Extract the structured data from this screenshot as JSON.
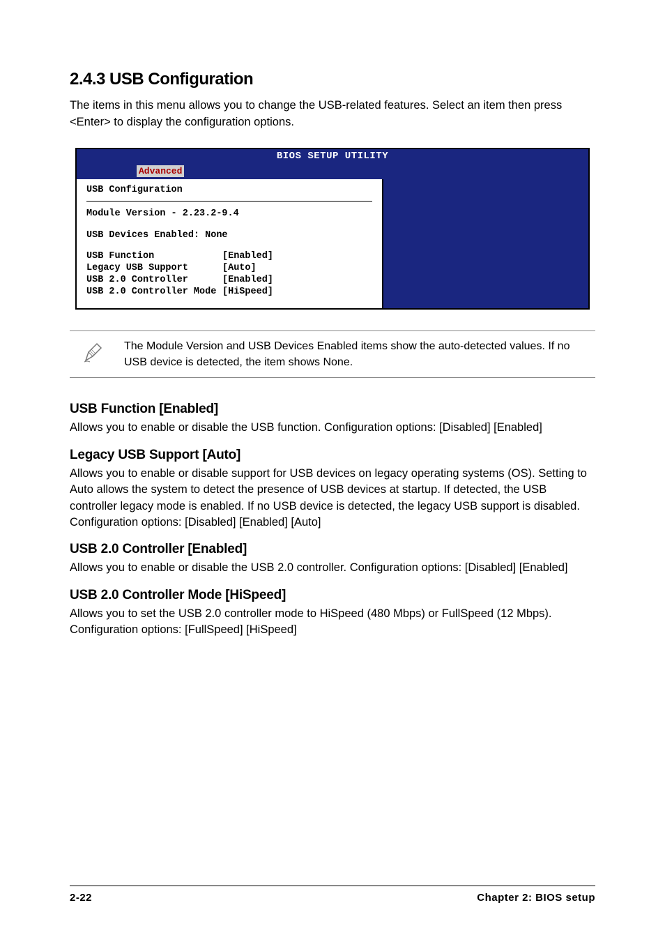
{
  "heading": "2.4.3   USB Configuration",
  "intro": "The items in this menu allows you to change the USB-related features. Select an item then press <Enter> to display the configuration options.",
  "bios": {
    "title": "BIOS SETUP UTILITY",
    "tab": "Advanced",
    "section_title": "USB Configuration",
    "module_version": "Module Version - 2.23.2-9.4",
    "devices_enabled": "USB Devices Enabled: None",
    "rows": [
      {
        "label": "USB Function",
        "value": "[Enabled]"
      },
      {
        "label": "Legacy USB Support",
        "value": "[Auto]"
      },
      {
        "label": "USB 2.0 Controller",
        "value": "[Enabled]"
      },
      {
        "label": "USB 2.0 Controller Mode",
        "value": "[HiSpeed]"
      }
    ]
  },
  "note": "The Module Version and USB Devices Enabled items show the auto-detected values. If no USB device is detected, the item shows None.",
  "sections": [
    {
      "heading": "USB Function [Enabled]",
      "body": "Allows you to enable or disable the USB function. Configuration options: [Disabled] [Enabled]"
    },
    {
      "heading": "Legacy USB Support [Auto]",
      "body": "Allows you to enable or disable support for USB devices on legacy operating systems (OS). Setting to Auto allows the system to detect the presence of USB devices at startup. If detected, the USB controller legacy mode is enabled. If no USB device is detected, the legacy USB support is disabled. Configuration options: [Disabled] [Enabled] [Auto]"
    },
    {
      "heading": "USB 2.0 Controller [Enabled]",
      "body": "Allows you to enable or disable the USB 2.0 controller. Configuration options: [Disabled] [Enabled]"
    },
    {
      "heading": "USB 2.0 Controller Mode [HiSpeed]",
      "body": "Allows you to set the USB 2.0 controller mode to HiSpeed (480 Mbps) or FullSpeed (12 Mbps). Configuration options: [FullSpeed] [HiSpeed]"
    }
  ],
  "footer": {
    "left": "2-22",
    "right": "Chapter 2: BIOS setup"
  }
}
